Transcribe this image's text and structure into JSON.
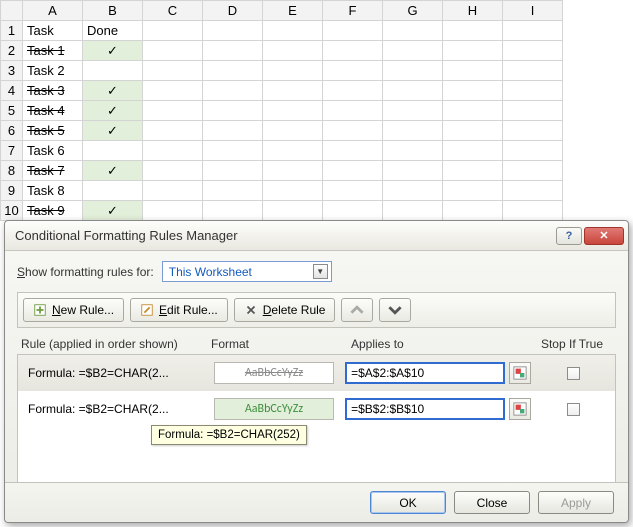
{
  "spreadsheet": {
    "col_headers": [
      "A",
      "B",
      "C",
      "D",
      "E",
      "F",
      "G",
      "H",
      "I"
    ],
    "row_headers": [
      "1",
      "2",
      "3",
      "4",
      "5",
      "6",
      "7",
      "8",
      "9",
      "10"
    ],
    "header_row": {
      "a": "Task",
      "b": "Done"
    },
    "tasks": [
      {
        "name": "Task 1",
        "done": true
      },
      {
        "name": "Task 2",
        "done": false
      },
      {
        "name": "Task 3",
        "done": true
      },
      {
        "name": "Task 4",
        "done": true
      },
      {
        "name": "Task 5",
        "done": true
      },
      {
        "name": "Task 6",
        "done": false
      },
      {
        "name": "Task 7",
        "done": true
      },
      {
        "name": "Task 8",
        "done": false
      },
      {
        "name": "Task 9",
        "done": true
      }
    ],
    "check_glyph": "✓"
  },
  "dialog": {
    "title": "Conditional Formatting Rules Manager",
    "show_label": "Show formatting rules for:",
    "show_value": "This Worksheet",
    "toolbar": {
      "new_rule": "New Rule...",
      "edit_rule": "Edit Rule...",
      "delete_rule": "Delete Rule"
    },
    "columns": {
      "rule": "Rule (applied in order shown)",
      "format": "Format",
      "applies": "Applies to",
      "stop": "Stop If True"
    },
    "format_sample": "AaBbCcYyZz",
    "rules": [
      {
        "label": "Formula: =$B2=CHAR(2...",
        "applies": "=$A$2:$A$10",
        "style": "strike",
        "selected": true
      },
      {
        "label": "Formula: =$B2=CHAR(2...",
        "applies": "=$B$2:$B$10",
        "style": "green",
        "selected": false
      }
    ],
    "tooltip": "Formula: =$B2=CHAR(252)",
    "footer": {
      "ok": "OK",
      "close": "Close",
      "apply": "Apply"
    }
  }
}
